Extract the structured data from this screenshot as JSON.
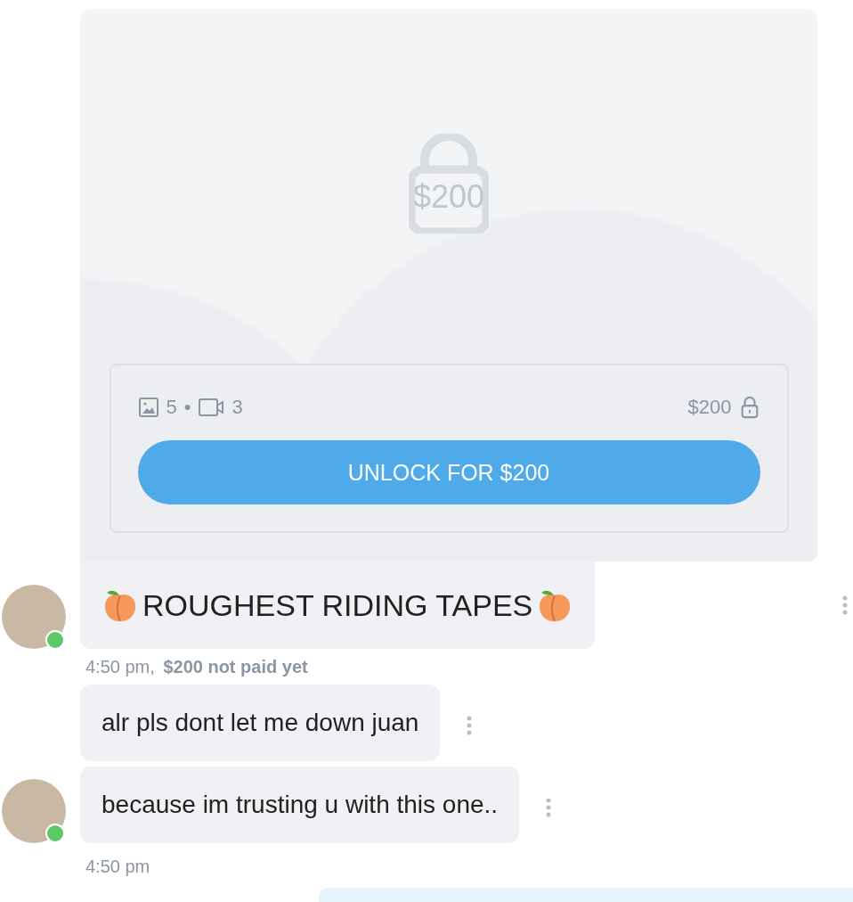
{
  "locked_post": {
    "price_overlay": "$200",
    "photos": "5",
    "separator": "•",
    "videos": "3",
    "price": "$200",
    "unlock_button": "UNLOCK FOR $200"
  },
  "messages": [
    {
      "kind": "title",
      "text": "ROUGHEST RIDING TAPES",
      "avatar": true,
      "online": true
    },
    {
      "kind": "meta",
      "text": "4:50 pm, **$200 not paid yet**"
    },
    {
      "kind": "text",
      "text": "alr pls dont let me down juan",
      "avatar": false,
      "online": false
    },
    {
      "kind": "text",
      "text": "because im trusting u with this one..",
      "avatar": true,
      "online": true
    },
    {
      "kind": "meta",
      "text": "4:50 pm"
    },
    {
      "kind": "outgoing"
    }
  ]
}
